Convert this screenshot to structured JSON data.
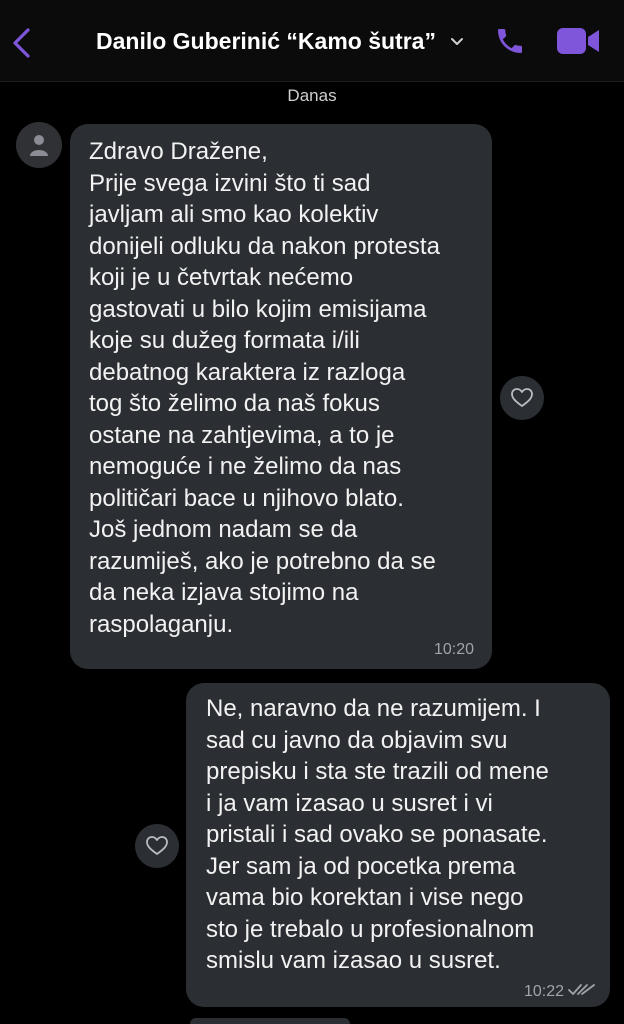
{
  "header": {
    "back_icon": "chevron-left-icon",
    "title": "Danilo Guberinić “Kamo šutra”",
    "accent_color": "#7f56d9"
  },
  "date_separator": "Danas",
  "messages": [
    {
      "direction": "incoming",
      "text": "Zdravo Dražene,\nPrije svega izvini što ti sad\njavljam ali smo kao kolektiv\ndonijeli odluku da nakon protesta\nkoji je u četvrtak nećemo\ngastovati u bilo kojim emisijama\nkoje su dužeg formata i/ili\ndebatnog karaktera iz razloga\ntog što želimo da naš fokus\nostane na zahtjevima, a to je\nnemoguće i ne želimo da nas\npolitičari bace u njihovo blato.\nJoš jednom nadam se da\nrazumiješ, ako je potrebno da se\nda neka izjava stojimo na\nraspolaganju.",
      "time": "10:20"
    },
    {
      "direction": "outgoing",
      "text": "Ne, naravno da ne razumijem. I\nsad cu javno da objavim svu\nprepisku i sta ste trazili od mene\ni ja vam izasao u susret i vi\npristali i sad ovako se ponasate.\nJer sam ja od pocetka prema\nvama bio korektan i vise nego\nsto je trebalo u profesionalnom\nsmislu vam izasao u susret.",
      "time": "10:22",
      "status_icon": "double-check-icon"
    }
  ],
  "colors": {
    "background": "#000000",
    "bubble": "#2b2e33",
    "accent": "#7f56d9"
  }
}
